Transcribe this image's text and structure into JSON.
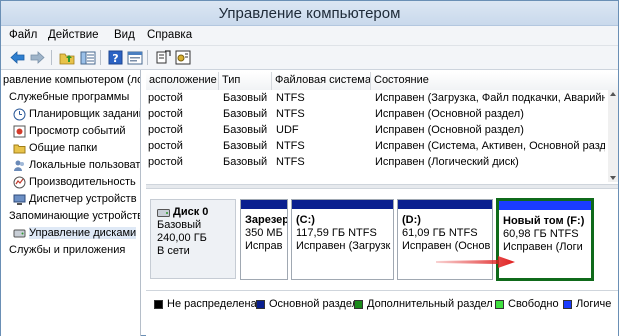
{
  "window": {
    "title": "Управление компьютером"
  },
  "menu": [
    "Файл",
    "Действие",
    "Вид",
    "Справка"
  ],
  "toolbar": {
    "icons": [
      "back-arrow-icon",
      "forward-arrow-icon",
      "folder-up-icon",
      "show-tree-icon",
      "help-icon",
      "properties-icon",
      "connect-icon",
      "settings-icon"
    ]
  },
  "tree": {
    "items": [
      {
        "label": "равление компьютером (ло",
        "icon": "computer-icon",
        "indent": 0
      },
      {
        "label": "Служебные программы",
        "icon": "none",
        "indent": 0
      },
      {
        "label": "Планировщик заданий",
        "icon": "clock-icon",
        "indent": 1
      },
      {
        "label": "Просмотр событий",
        "icon": "events-icon",
        "indent": 1
      },
      {
        "label": "Общие папки",
        "icon": "folder-icon",
        "indent": 1
      },
      {
        "label": "Локальные пользовате",
        "icon": "users-icon",
        "indent": 1
      },
      {
        "label": "Производительность",
        "icon": "performance-icon",
        "indent": 1
      },
      {
        "label": "Диспетчер устройств",
        "icon": "device-manager-icon",
        "indent": 1
      },
      {
        "label": "Запоминающие устройств",
        "icon": "none",
        "indent": 0
      },
      {
        "label": "Управление дисками",
        "icon": "disk-icon",
        "indent": 1,
        "selected": true
      },
      {
        "label": "Службы и приложения",
        "icon": "none",
        "indent": 0
      }
    ]
  },
  "volumes": {
    "columns": [
      "асположение",
      "Тип",
      "Файловая система",
      "Состояние"
    ],
    "rows": [
      [
        "ростой",
        "Базовый",
        "NTFS",
        "Исправен (Загрузка, Файл подкачки, Аварийны"
      ],
      [
        "ростой",
        "Базовый",
        "NTFS",
        "Исправен (Основной раздел)"
      ],
      [
        "ростой",
        "Базовый",
        "UDF",
        "Исправен (Основной раздел)"
      ],
      [
        "ростой",
        "Базовый",
        "NTFS",
        "Исправен (Система, Активен, Основной разде"
      ],
      [
        "ростой",
        "Базовый",
        "NTFS",
        "Исправен (Логический диск)"
      ]
    ]
  },
  "disk": {
    "name": "Диск 0",
    "type": "Базовый",
    "size": "240,00 ГБ",
    "status": "В сети",
    "partitions": [
      {
        "name": "Зарезер",
        "size": "350 МБ",
        "status": "Исправ",
        "bar_color": "#0a1f8f"
      },
      {
        "name": "(C:)",
        "size": "117,59 ГБ NTFS",
        "status": "Исправен (Загрузк",
        "bar_color": "#0a1f8f"
      },
      {
        "name": "(D:)",
        "size": "61,09 ГБ NTFS",
        "status": "Исправен (Основ",
        "bar_color": "#0a1f8f"
      },
      {
        "name": "Новый том  (F:)",
        "size": "60,98 ГБ NTFS",
        "status": "Исправен (Логи",
        "bar_color": "#1a3cff"
      }
    ]
  },
  "legend": [
    {
      "label": "Не распределена",
      "color": "#000000"
    },
    {
      "label": "Основной раздел",
      "color": "#0a1f8f"
    },
    {
      "label": "Дополнительный раздел",
      "color": "#1a8a1a"
    },
    {
      "label": "Свободно",
      "color": "#40e040"
    },
    {
      "label": "Логиче",
      "color": "#1a3cff"
    }
  ],
  "colors": {
    "highlight_border": "#0f6a1a",
    "arrow": "#e02020"
  }
}
